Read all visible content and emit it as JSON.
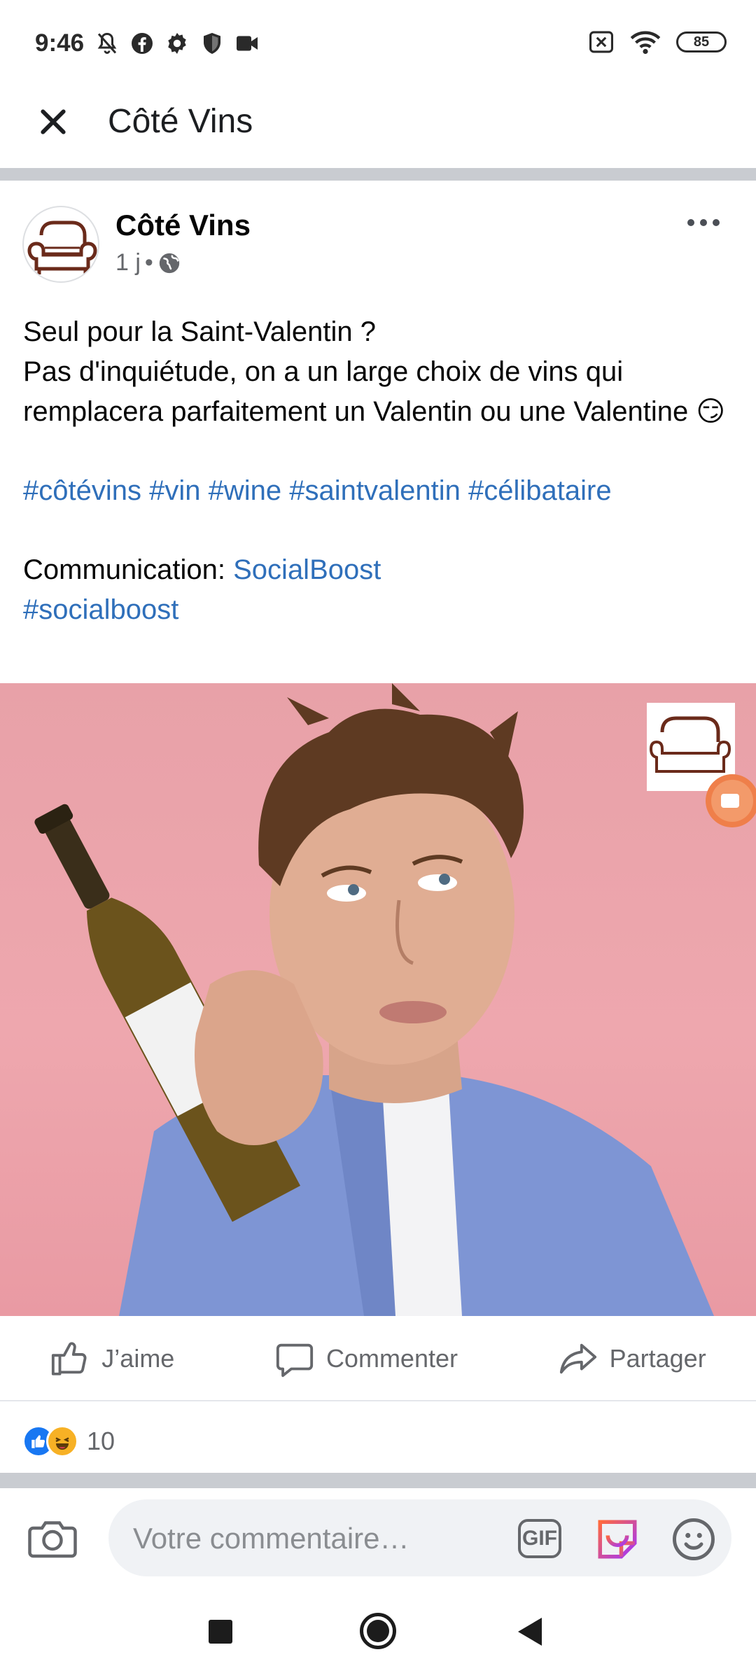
{
  "status_bar": {
    "time": "9:46",
    "battery": "85",
    "left_icons": [
      "notifications-off-icon",
      "facebook-icon",
      "settings-icon",
      "shield-icon",
      "video-icon"
    ],
    "right_icons": [
      "no-sim-icon",
      "wifi-icon",
      "battery-icon"
    ]
  },
  "app_bar": {
    "title": "Côté Vins",
    "close_icon": "close-icon"
  },
  "post": {
    "page_name": "Côté Vins",
    "time": "1 j",
    "separator": "•",
    "privacy_icon": "globe-icon",
    "text_lines": [
      "Seul pour la Saint-Valentin ?",
      "Pas d'inquiétude, on a un large choix de vins qui remplacera parfaitement un Valentin ou une Valentine 😏"
    ],
    "hashtags": [
      "#côtévins",
      "#vin",
      "#wine",
      "#saintvalentin",
      "#célibataire"
    ],
    "communication_label": "Communication: ",
    "communication_link": "SocialBoost",
    "extra_hashtag": "#socialboost",
    "image_icon": "camera-record-icon"
  },
  "actions": {
    "like": "J’aime",
    "comment": "Commenter",
    "share": "Partager"
  },
  "reactions": {
    "types": [
      "like-reaction-icon",
      "haha-reaction-icon"
    ],
    "count": "10"
  },
  "comment_bar": {
    "placeholder": "Votre commentaire…",
    "gif_label": "GIF"
  },
  "colors": {
    "link": "#2f6fba",
    "like_blue": "#1877f2",
    "divider": "#c9ccd1",
    "image_background": "#eea7ae"
  }
}
